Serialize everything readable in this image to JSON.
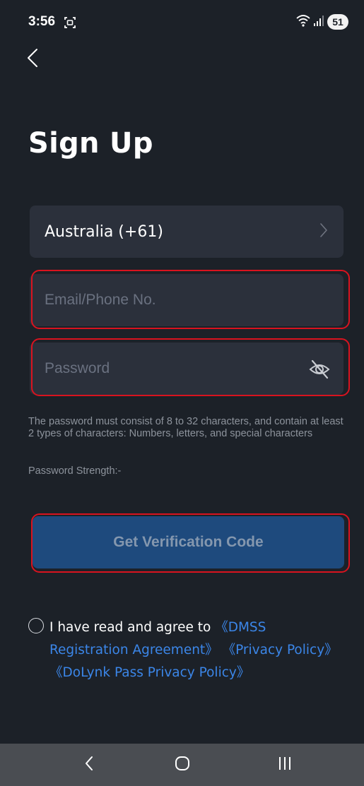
{
  "status_bar": {
    "time": "3:56",
    "battery": "51"
  },
  "header": {
    "title": "Sign Up"
  },
  "form": {
    "country": "Australia (+61)",
    "email_placeholder": "Email/Phone No.",
    "password_placeholder": "Password",
    "password_hint": "The password must consist of 8 to 32 characters, and contain at least 2 types of characters: Numbers, letters, and special characters",
    "strength_label": "Password Strength:",
    "strength_value": "-",
    "verify_button": "Get Verification Code"
  },
  "agreement": {
    "prefix": "I have read and agree to ",
    "link1": "《DMSS Registration Agreement》",
    "link2": "《Privacy Policy》",
    "link3": "《DoLynk Pass Privacy Policy》"
  },
  "colors": {
    "background": "#1c2128",
    "field": "#2b303b",
    "button": "#1e4a7d",
    "link": "#3b86e8",
    "highlight": "#d9131f"
  },
  "icons": {
    "back": "chevron-left-icon",
    "country_arrow": "chevron-right-icon",
    "eye": "eye-off-icon",
    "nav_back": "nav-back-icon",
    "nav_home": "nav-home-icon",
    "nav_recent": "nav-recent-icon"
  }
}
